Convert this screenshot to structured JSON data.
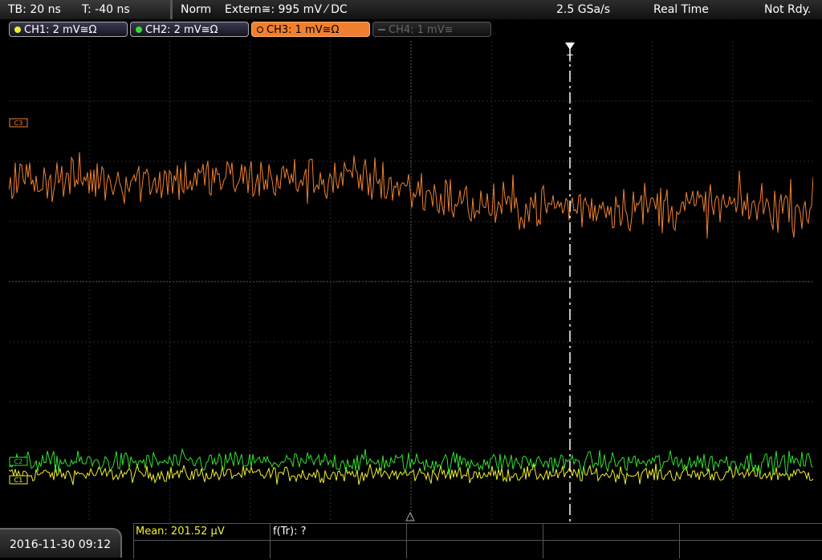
{
  "status": {
    "timebase": "TB: 20 ns",
    "trigger_time": "T: -40 ns",
    "mode": "Norm",
    "trigger_source": "Extern≅: 995 mV ⁄ DC",
    "sample_rate": "2.5 GSa/s",
    "acquisition": "Real Time",
    "run_state": "Not Rdy."
  },
  "channels": [
    {
      "label": "CH1: 2 mV≅Ω",
      "color": "#f0f030"
    },
    {
      "label": "CH2: 2 mV≅Ω",
      "color": "#30e030"
    },
    {
      "label": "CH3: 1 mV≅Ω",
      "color": "#f08030"
    },
    {
      "label": "CH4: 1 mV≅",
      "color": "#777777"
    }
  ],
  "trigger_marker": "T",
  "channel_markers": [
    "C1",
    "C2",
    "C3"
  ],
  "measurements": {
    "mean": "Mean: 201.52 µV",
    "freq": "f(Tr): ?"
  },
  "datetime": "2016-11-30 09:12",
  "waveforms": {
    "ch3": {
      "color": "#f08030",
      "level_start_div": 1.7,
      "level_end_div": 1.25,
      "noise_div": 0.42
    },
    "ch2": {
      "color": "#30e030",
      "level_div": -3.0,
      "noise_div": 0.18
    },
    "ch1": {
      "color": "#f0f030",
      "level_div": -3.2,
      "noise_div": 0.14
    }
  }
}
